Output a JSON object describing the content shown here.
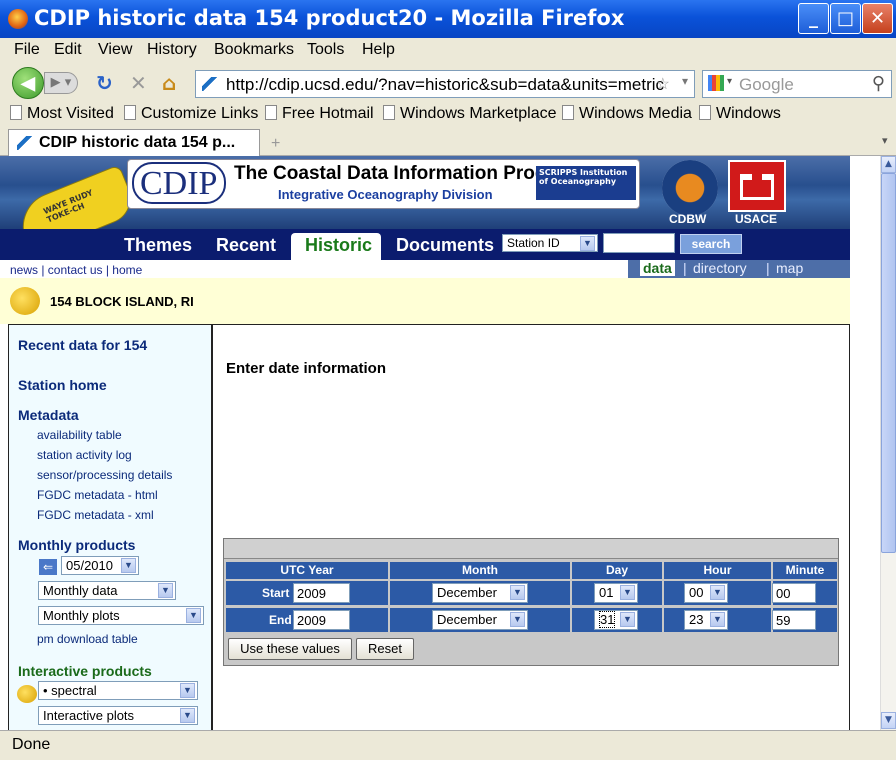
{
  "window": {
    "title": "CDIP historic data 154 product20 - Mozilla Firefox"
  },
  "menu": [
    "File",
    "Edit",
    "View",
    "History",
    "Bookmarks",
    "Tools",
    "Help"
  ],
  "nav": {
    "url": "http://cdip.ucsd.edu/?nav=historic&sub=data&units=metric",
    "search_placeholder": "Google"
  },
  "bookmarks": [
    "Most Visited",
    "Customize Links",
    "Free Hotmail",
    "Windows Marketplace",
    "Windows Media",
    "Windows"
  ],
  "tab": {
    "title": "CDIP historic data 154 p..."
  },
  "site": {
    "logo_text": "CDIP",
    "program_title": "The Coastal Data Information Program",
    "program_subtitle": "Integrative Oceanography Division",
    "scripps": "SCRIPPS Institution of Oceanography",
    "partner1": "CDBW",
    "partner2": "USACE",
    "buoy_text": "WAYE RUDY TOKE-CH",
    "tabs": [
      "Themes",
      "Recent",
      "Historic",
      "Documents"
    ],
    "station_select": "Station ID",
    "search_button": "search",
    "top_links": "news | contact us | home",
    "sub_links": [
      "data",
      "directory",
      "map"
    ],
    "station_name": "154 BLOCK ISLAND, RI"
  },
  "sidebar": {
    "recent": "Recent data for 154",
    "station_home": "Station home",
    "metadata_heading": "Metadata",
    "metadata_links": [
      "availability table",
      "station activity log",
      "sensor/processing details",
      "FGDC metadata - html",
      "FGDC metadata - xml"
    ],
    "monthly_heading": "Monthly products",
    "month_value": "05/2010",
    "monthly_data": "Monthly data",
    "monthly_plots": "Monthly plots",
    "pm_link": "pm download table",
    "interactive_heading": "Interactive products",
    "spectral": "• spectral",
    "interactive_plots": "Interactive plots"
  },
  "form": {
    "heading": "Enter date information",
    "headers": [
      "UTC Year",
      "Month",
      "Day",
      "Hour",
      "Minute"
    ],
    "start": {
      "label": "Start",
      "year": "2009",
      "month": "December",
      "day": "01",
      "hour": "00",
      "minute": "00"
    },
    "end": {
      "label": "End",
      "year": "2009",
      "month": "December",
      "day": "31",
      "hour": "23",
      "minute": "59"
    },
    "use_button": "Use these values",
    "reset_button": "Reset"
  },
  "status": "Done"
}
